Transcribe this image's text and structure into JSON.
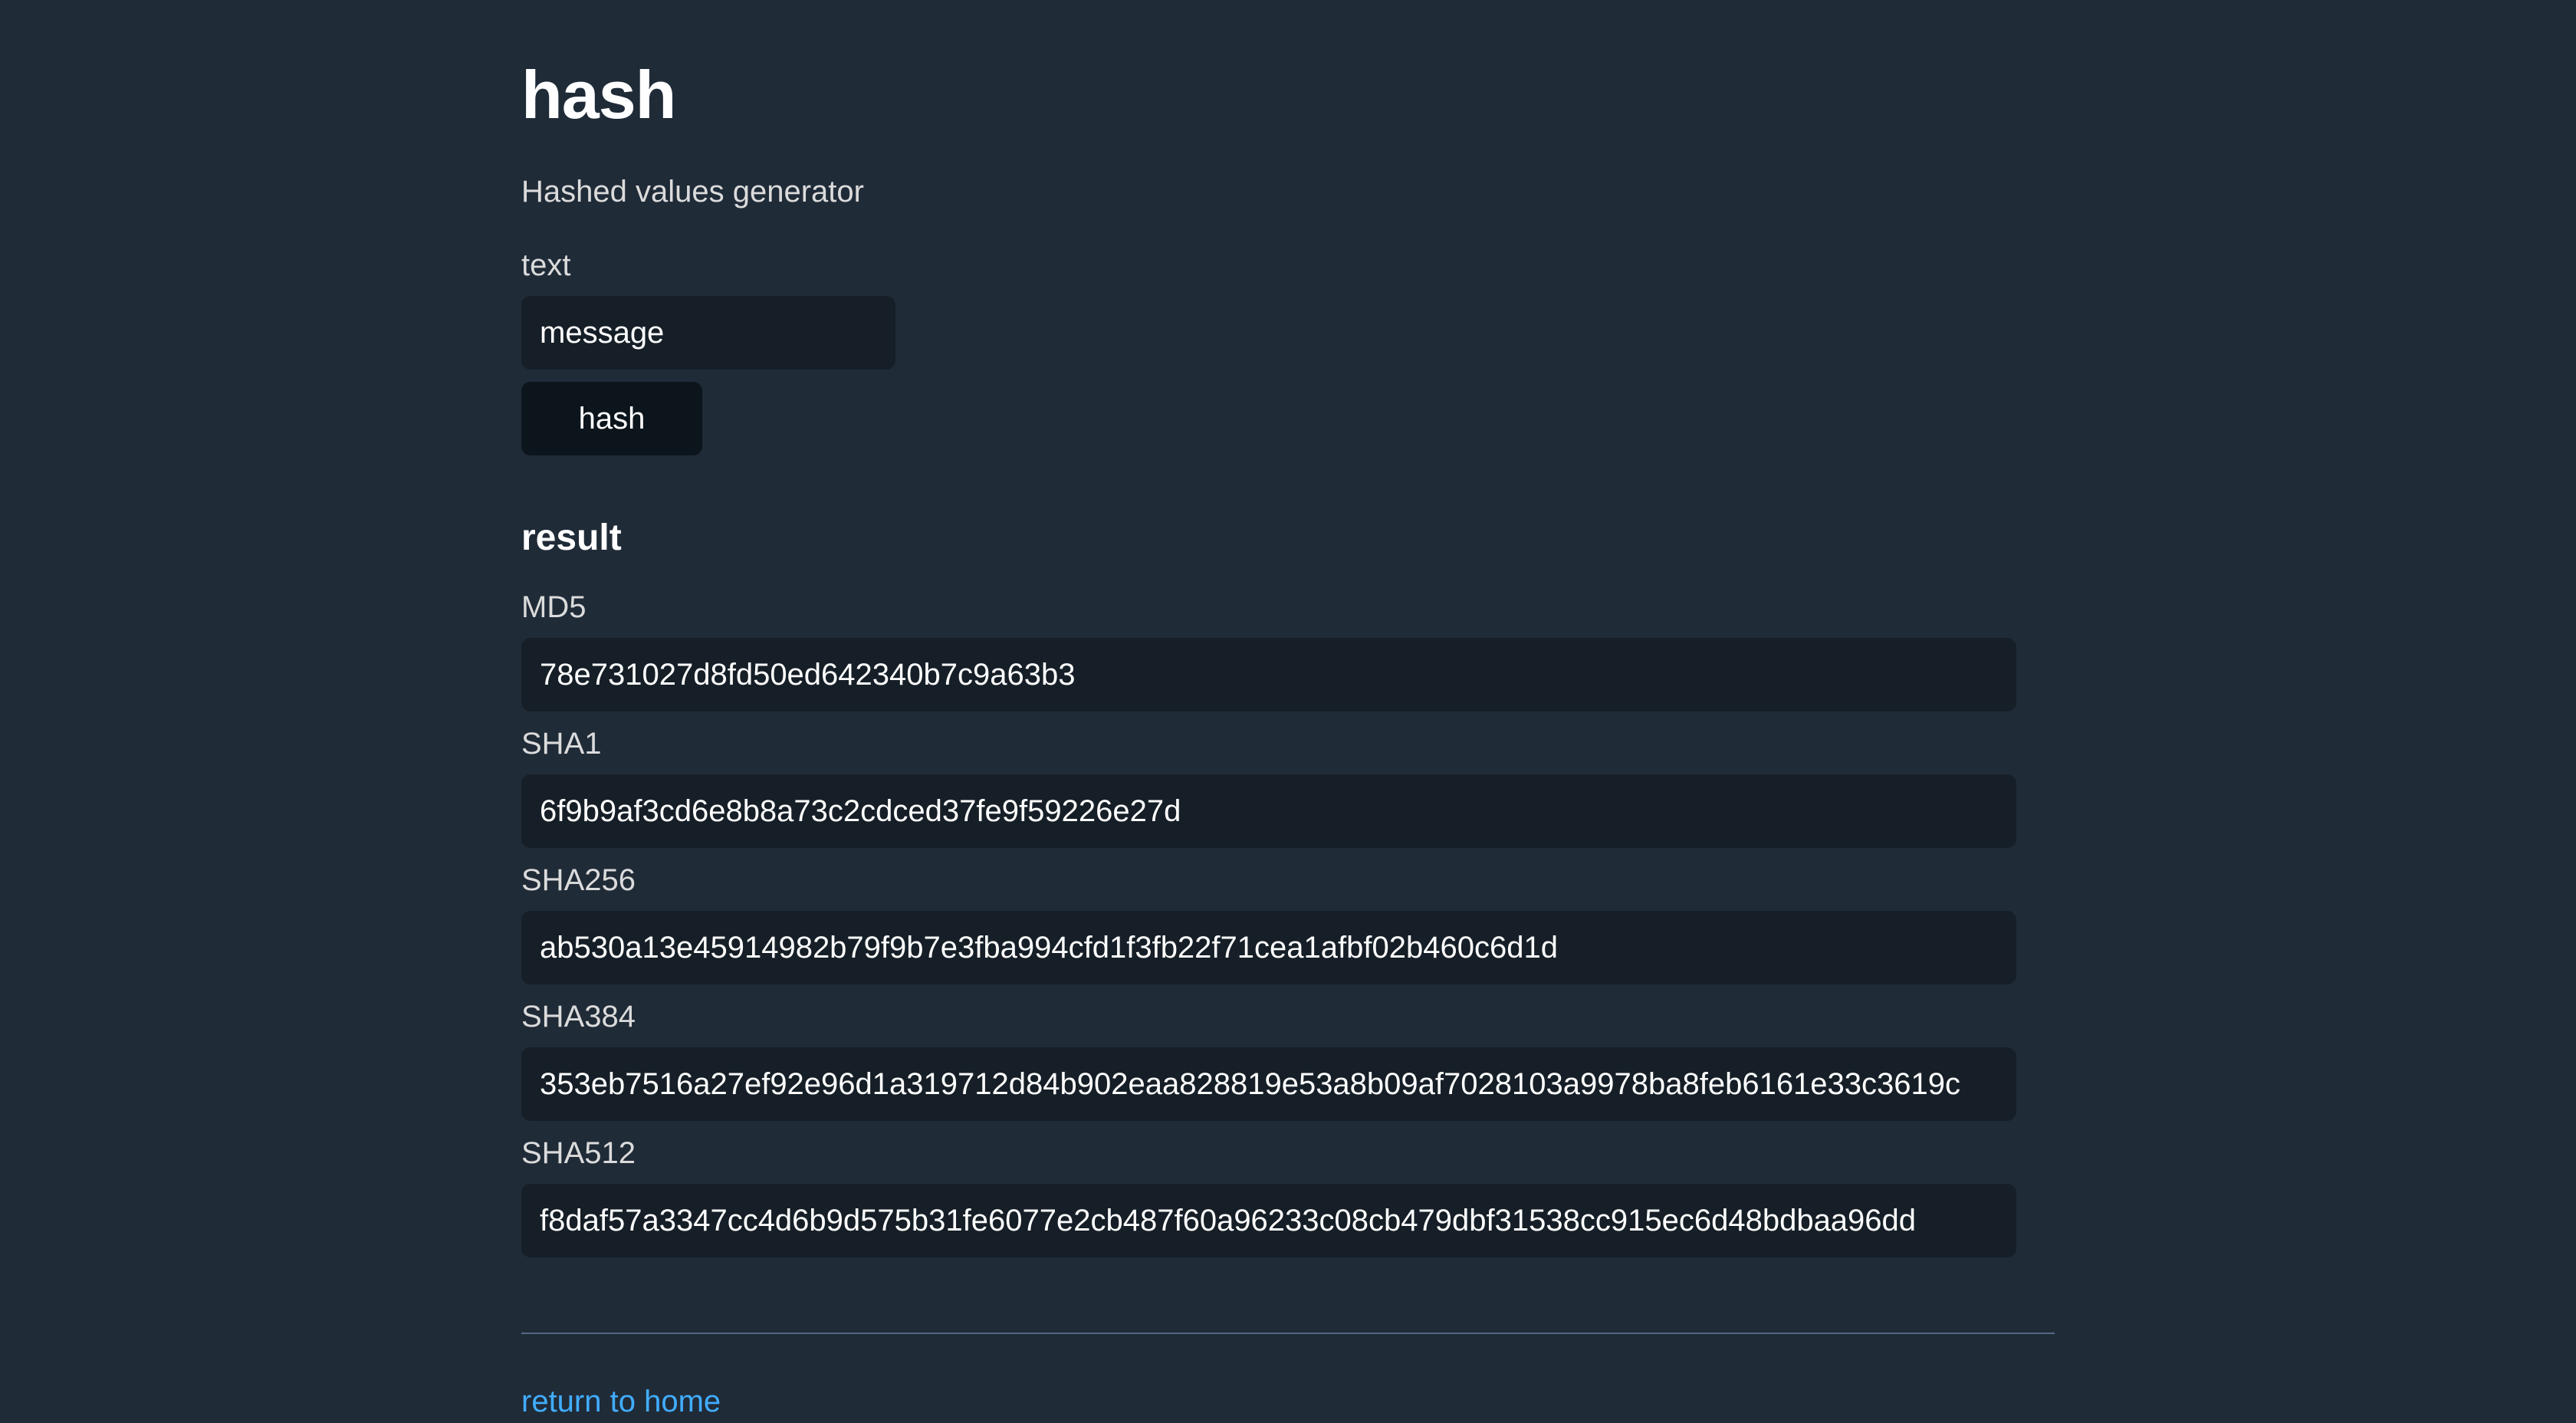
{
  "page": {
    "title": "hash",
    "subtitle": "Hashed values generator"
  },
  "form": {
    "text_label": "text",
    "text_value": "message",
    "button_label": "hash"
  },
  "result": {
    "heading": "result",
    "hashes": [
      {
        "label": "MD5",
        "value": "78e731027d8fd50ed642340b7c9a63b3"
      },
      {
        "label": "SHA1",
        "value": "6f9b9af3cd6e8b8a73c2cdced37fe9f59226e27d"
      },
      {
        "label": "SHA256",
        "value": "ab530a13e45914982b79f9b7e3fba994cfd1f3fb22f71cea1afbf02b460c6d1d"
      },
      {
        "label": "SHA384",
        "value": "353eb7516a27ef92e96d1a319712d84b902eaa828819e53a8b09af7028103a9978ba8feb6161e33c3619c"
      },
      {
        "label": "SHA512",
        "value": "f8daf57a3347cc4d6b9d575b31fe6077e2cb487f60a96233c08cb479dbf31538cc915ec6d48bdbaa96dd"
      }
    ]
  },
  "footer": {
    "link_text": "return to home"
  },
  "colors": {
    "background": "#202b38",
    "input_background": "#161f27",
    "button_background": "#0c151c",
    "text": "#dbdbdb",
    "heading": "#ffffff",
    "link": "#41adff"
  }
}
